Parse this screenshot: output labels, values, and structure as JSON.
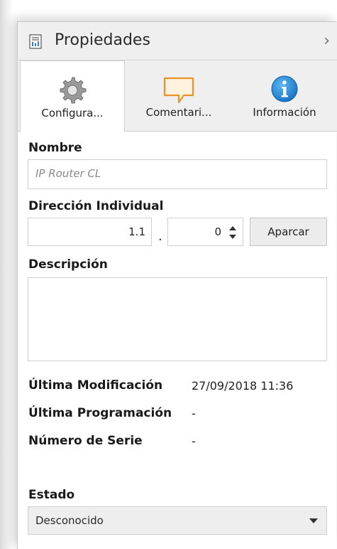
{
  "panel": {
    "title": "Propiedades",
    "collapse_glyph": "›"
  },
  "tabs": [
    {
      "label": "Configura...",
      "icon": "gear-icon",
      "active": true
    },
    {
      "label": "Comentari...",
      "icon": "comment-icon",
      "active": false
    },
    {
      "label": "Información",
      "icon": "info-icon",
      "active": false
    }
  ],
  "form": {
    "name_label": "Nombre",
    "name_placeholder": "IP Router CL",
    "address_label": "Dirección Individual",
    "address_main": "1.1",
    "address_separator": ".",
    "address_device": "0",
    "park_button": "Aparcar",
    "description_label": "Descripción",
    "description_value": ""
  },
  "info": [
    {
      "label": "Última Modificación",
      "value": "27/09/2018 11:36"
    },
    {
      "label": "Última Programación",
      "value": "-"
    },
    {
      "label": "Número de Serie",
      "value": "-"
    }
  ],
  "status": {
    "label": "Estado",
    "value": "Desconocido"
  },
  "colors": {
    "info_icon_blue": "#1e88d8",
    "comment_icon_orange": "#f0a43a",
    "gear_gray": "#8c8c8c"
  }
}
